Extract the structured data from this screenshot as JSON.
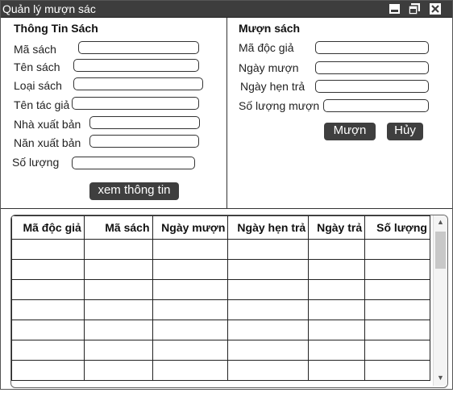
{
  "window": {
    "title": "Quản lý mượn sác"
  },
  "book_info": {
    "heading": "Thông Tin Sách",
    "fields": [
      {
        "label": "Mã sách",
        "value": ""
      },
      {
        "label": "Tên sách",
        "value": ""
      },
      {
        "label": "Loại sách",
        "value": ""
      },
      {
        "label": "Tên tác giả",
        "value": ""
      },
      {
        "label": "Nhà xuất bản",
        "value": ""
      },
      {
        "label": "Năn xuất bản",
        "value": ""
      },
      {
        "label": "Số lượng",
        "value": ""
      }
    ],
    "view_button": "xem thông tin"
  },
  "borrow": {
    "heading": "Mượn sách",
    "fields": [
      {
        "label": "Mã độc giả",
        "value": ""
      },
      {
        "label": "Ngày mượn",
        "value": ""
      },
      {
        "label": "Ngày hẹn trả",
        "value": ""
      },
      {
        "label": "Số lượng mượn",
        "value": ""
      }
    ],
    "borrow_button": "Mượn",
    "cancel_button": "Hủy"
  },
  "table": {
    "columns": [
      "Mã độc giả",
      "Mã sách",
      "Ngày mượn",
      "Ngày hẹn trả",
      "Ngày trả",
      "Số lượng"
    ],
    "rows": [
      [
        "",
        "",
        "",
        "",
        "",
        ""
      ],
      [
        "",
        "",
        "",
        "",
        "",
        ""
      ],
      [
        "",
        "",
        "",
        "",
        "",
        ""
      ],
      [
        "",
        "",
        "",
        "",
        "",
        ""
      ],
      [
        "",
        "",
        "",
        "",
        "",
        ""
      ],
      [
        "",
        "",
        "",
        "",
        "",
        ""
      ],
      [
        "",
        "",
        "",
        "",
        "",
        ""
      ]
    ]
  },
  "icons": {
    "minimize": "minimize-icon",
    "restore": "restore-icon",
    "close": "close-icon"
  }
}
